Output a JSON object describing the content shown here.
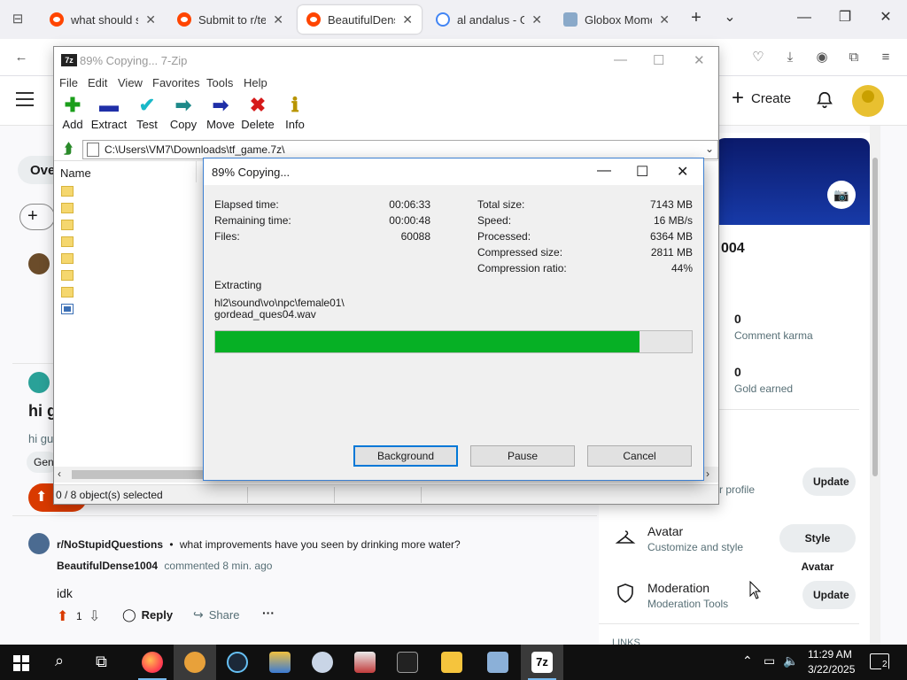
{
  "browser": {
    "tabs": [
      {
        "title": "what should some",
        "icon": "reddit-icon",
        "active": false
      },
      {
        "title": "Submit to r/techs",
        "icon": "reddit-icon",
        "active": false
      },
      {
        "title": "BeautifulDense1",
        "icon": "reddit-icon",
        "active": true
      },
      {
        "title": "al andalus - Goo",
        "icon": "google-icon",
        "active": false
      },
      {
        "title": "Globox Moment",
        "icon": "globox-icon",
        "active": false
      }
    ],
    "new_tab_label": "+",
    "tab_list_label": "⌄"
  },
  "reddit": {
    "create_label": "Create",
    "left": {
      "overview_partial": "Ove",
      "post_title_partial": "hi g",
      "post_sub_partial": "hi gu",
      "tag_partial": "Gen"
    },
    "sidebar": {
      "username_tail": "004",
      "stats": [
        {
          "value": "0",
          "label": "Comment karma"
        },
        {
          "value": "0",
          "label": "Gold earned"
        }
      ],
      "profile_row_partial": "r profile",
      "profile_button": "Update",
      "avatar_row": {
        "title": "Avatar",
        "subtitle": "Customize and style",
        "button": "Style Avatar"
      },
      "moderation_row": {
        "title": "Moderation",
        "subtitle": "Moderation Tools",
        "button": "Update"
      },
      "links_partial": "LINKS"
    },
    "comment": {
      "subreddit": "r/NoStupidQuestions",
      "separator": "•",
      "post_title": "what improvements have you seen by drinking more water?",
      "author": "BeautifulDense1004",
      "meta": "commented 8 min. ago",
      "body": "idk",
      "votes": "1",
      "reply_label": "Reply",
      "share_label": "Share",
      "more_label": "···"
    }
  },
  "zip_main": {
    "title": "89% Copying... 7-Zip",
    "logo": "7z",
    "menu": [
      "File",
      "Edit",
      "View",
      "Favorites",
      "Tools",
      "Help"
    ],
    "tools": [
      {
        "label": "Add",
        "icon": "add-icon",
        "glyph": "✚",
        "color": "#1a9e1a"
      },
      {
        "label": "Extract",
        "icon": "extract-icon",
        "glyph": "▬",
        "color": "#1f2fa8"
      },
      {
        "label": "Test",
        "icon": "test-icon",
        "glyph": "✔",
        "color": "#19b8c8"
      },
      {
        "label": "Copy",
        "icon": "copy-icon",
        "glyph": "➡",
        "color": "#1f8a8a"
      },
      {
        "label": "Move",
        "icon": "move-icon",
        "glyph": "➡",
        "color": "#1f2fa8"
      },
      {
        "label": "Delete",
        "icon": "delete-icon",
        "glyph": "✖",
        "color": "#d61a1a"
      },
      {
        "label": "Info",
        "icon": "info-icon",
        "glyph": "ℹ",
        "color": "#b89400"
      }
    ],
    "address": "C:\\Users\\VM7\\Downloads\\tf_game.7z\\",
    "list_header": "Name",
    "status": "0 / 8 object(s) selected"
  },
  "progress": {
    "title": "89% Copying...",
    "left": [
      {
        "label": "Elapsed time:",
        "value": "00:06:33"
      },
      {
        "label": "Remaining time:",
        "value": "00:00:48"
      },
      {
        "label": "Files:",
        "value": "60088"
      }
    ],
    "right": [
      {
        "label": "Total size:",
        "value": "7143 MB"
      },
      {
        "label": "Speed:",
        "value": "16 MB/s"
      },
      {
        "label": "Processed:",
        "value": "6364 MB"
      },
      {
        "label": "Compressed size:",
        "value": "2811 MB"
      },
      {
        "label": "Compression ratio:",
        "value": "44%"
      }
    ],
    "action": "Extracting",
    "file_line1": "hl2\\sound\\vo\\npc\\female01\\",
    "file_line2": "gordead_ques04.wav",
    "percent": 89,
    "buttons": {
      "background": "Background",
      "pause": "Pause",
      "cancel": "Cancel"
    }
  },
  "taskbar": {
    "time": "11:29 AM",
    "date": "3/22/2025",
    "notifications": "2"
  }
}
